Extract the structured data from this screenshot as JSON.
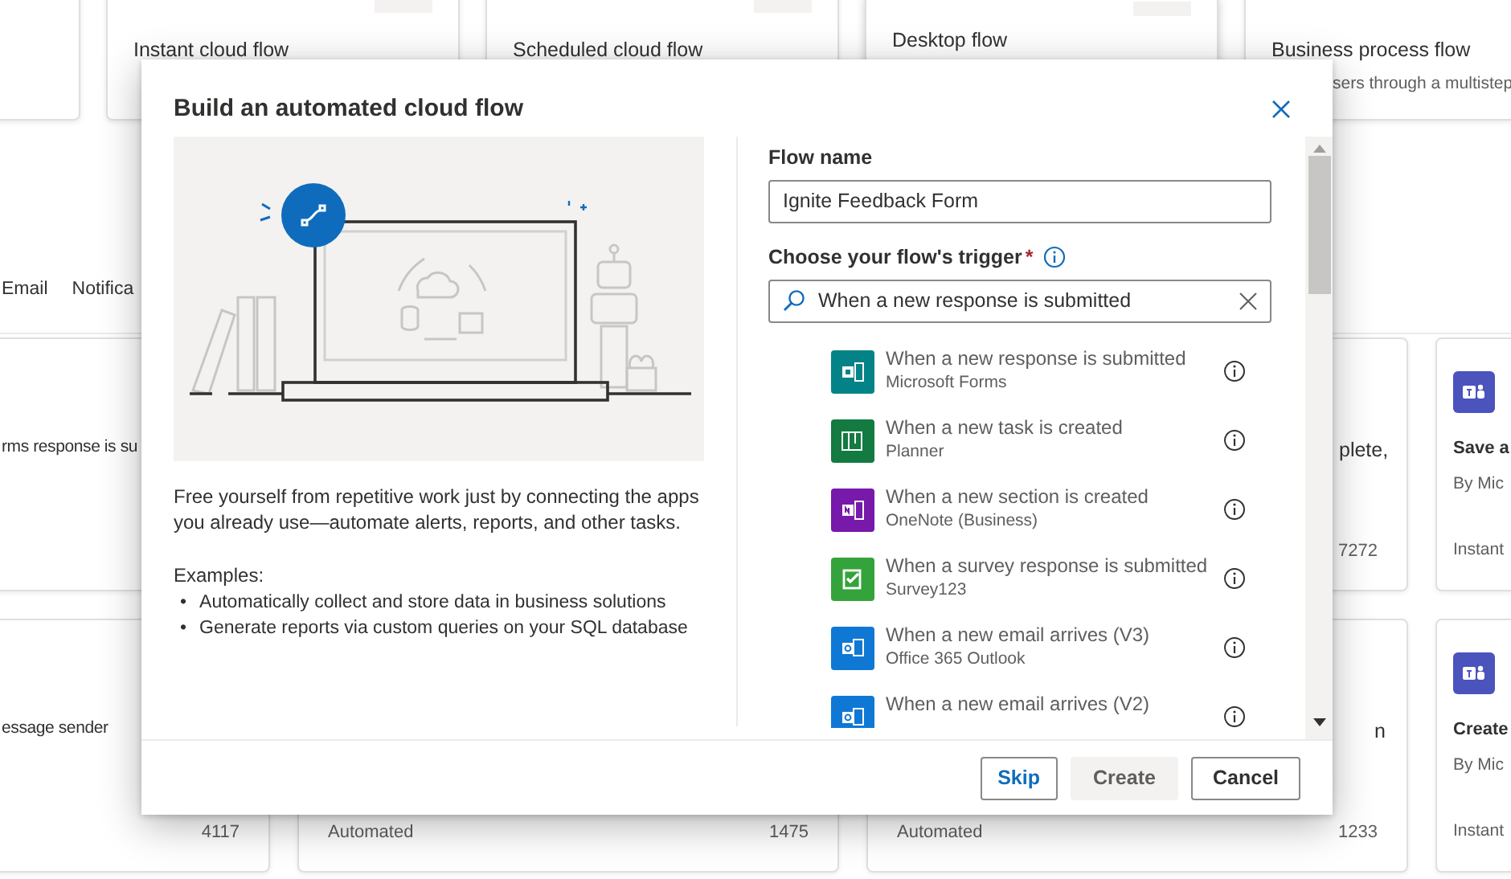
{
  "background": {
    "flow_types": [
      {
        "kind": "blank"
      },
      {
        "kind": "card",
        "title": "Instant cloud flow"
      },
      {
        "kind": "card",
        "title": "Scheduled cloud flow"
      },
      {
        "kind": "card",
        "title": "Desktop flow",
        "raised": true
      },
      {
        "kind": "card",
        "title": "Business process flow",
        "subtitle": "sers through a multistep"
      }
    ],
    "tabs": [
      "Email",
      "Notifica"
    ],
    "template_rows": [
      {
        "cards": [
          {
            "kind": "card",
            "title": "rms response is su"
          },
          {
            "kind": "blank"
          },
          {
            "kind": "card",
            "title": "plete,",
            "count": "7272"
          },
          {
            "kind": "teams",
            "title": "Save a",
            "byline": "By Mic",
            "type": "Instant"
          }
        ]
      },
      {
        "cards": [
          {
            "kind": "card",
            "title": "essage sender",
            "count": "4117"
          },
          {
            "kind": "card",
            "type": "Automated",
            "count": "1475"
          },
          {
            "kind": "card",
            "title": "n",
            "type": "Automated",
            "count": "1233"
          },
          {
            "kind": "teams",
            "title": "Create",
            "byline": "By Mic",
            "type": "Instant"
          }
        ]
      }
    ]
  },
  "dialog": {
    "title": "Build an automated cloud flow",
    "description": "Free yourself from repetitive work just by connecting the apps you already use—automate alerts, reports, and other tasks.",
    "examples_label": "Examples:",
    "examples": [
      {
        "bullet": "•",
        "text": "Automatically collect and store data in business solutions"
      },
      {
        "bullet": "•",
        "text": "Generate reports via custom queries on your SQL database"
      }
    ],
    "flow_name": {
      "label": "Flow name",
      "value": "Ignite Feedback Form"
    },
    "trigger": {
      "label": "Choose your flow's trigger",
      "required_mark": "*",
      "search_value": "When a new response is submitted"
    },
    "triggers": [
      {
        "title": "When a new response is submitted",
        "connector": "Microsoft Forms",
        "kind": "forms",
        "color": "#038387"
      },
      {
        "title": "When a new task is created",
        "connector": "Planner",
        "kind": "planner",
        "color": "#137a41"
      },
      {
        "title": "When a new section is created",
        "connector": "OneNote (Business)",
        "kind": "onenote",
        "color": "#7719aa"
      },
      {
        "title": "When a survey response is submitted",
        "connector": "Survey123",
        "kind": "survey",
        "color": "#35a33b"
      },
      {
        "title": "When a new email arrives (V3)",
        "connector": "Office 365 Outlook",
        "kind": "outlook",
        "color": "#0f78d4"
      },
      {
        "title": "When a new email arrives (V2)",
        "kind": "outlook",
        "color": "#0f78d4"
      }
    ],
    "buttons": [
      {
        "label": "Skip",
        "kind": "outline-primary"
      },
      {
        "label": "Create",
        "kind": "disabled"
      },
      {
        "label": "Cancel",
        "kind": "outline"
      }
    ]
  }
}
